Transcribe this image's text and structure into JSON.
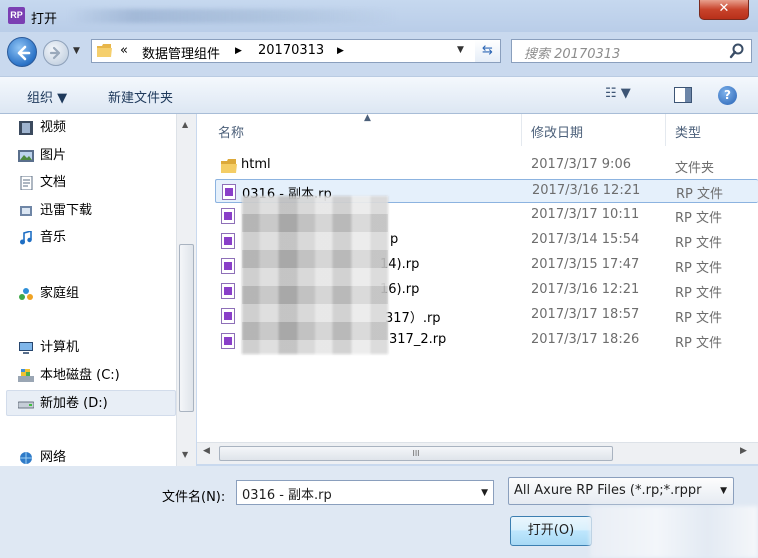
{
  "window": {
    "title": "打开",
    "app_icon_label": "RP",
    "close_label": "✕"
  },
  "address": {
    "chevron": "«",
    "segments": [
      "数据管理组件",
      "20170313"
    ],
    "search_placeholder": "搜索 20170313"
  },
  "toolbar": {
    "organize_label": "组织 ▼",
    "new_folder_label": "新建文件夹",
    "help_label": "?"
  },
  "nav": {
    "items": [
      {
        "label": "视频",
        "icon": "video-icon"
      },
      {
        "label": "图片",
        "icon": "picture-icon"
      },
      {
        "label": "文档",
        "icon": "document-icon"
      },
      {
        "label": "迅雷下载",
        "icon": "download-icon"
      },
      {
        "label": "音乐",
        "icon": "music-icon"
      },
      {
        "label": "家庭组",
        "icon": "homegroup-icon"
      },
      {
        "label": "计算机",
        "icon": "computer-icon"
      },
      {
        "label": "本地磁盘 (C:)",
        "icon": "drive-icon"
      },
      {
        "label": "新加卷 (D:)",
        "icon": "drive-icon"
      },
      {
        "label": "网络",
        "icon": "network-icon"
      }
    ],
    "selected_index": 8
  },
  "columns": {
    "name": "名称",
    "date": "修改日期",
    "type": "类型"
  },
  "files": [
    {
      "name": "html",
      "date": "2017/3/17 9:06",
      "type": "文件夹",
      "kind": "folder"
    },
    {
      "name": "0316 - 副本.rp",
      "date": "2017/3/16 12:21",
      "type": "RP 文件",
      "kind": "rp"
    },
    {
      "name": "",
      "date": "2017/3/17 10:11",
      "type": "RP 文件",
      "kind": "rp"
    },
    {
      "name": "p",
      "date": "2017/3/14 15:54",
      "type": "RP 文件",
      "kind": "rp"
    },
    {
      "name": "14).rp",
      "date": "2017/3/15 17:47",
      "type": "RP 文件",
      "kind": "rp"
    },
    {
      "name": "16).rp",
      "date": "2017/3/16 12:21",
      "type": "RP 文件",
      "kind": "rp"
    },
    {
      "name": "317）.rp",
      "date": "2017/3/17 18:57",
      "type": "RP 文件",
      "kind": "rp"
    },
    {
      "name": "317_2.rp",
      "date": "2017/3/17 18:26",
      "type": "RP 文件",
      "kind": "rp"
    }
  ],
  "selected_file_index": 1,
  "hscroll": {
    "grip": "III"
  },
  "bottom": {
    "filename_label": "文件名(N):",
    "filename_value": "0316 - 副本.rp",
    "filetype_value": "All Axure RP Files (*.rp;*.rppr",
    "open_label": "打开(O)"
  }
}
